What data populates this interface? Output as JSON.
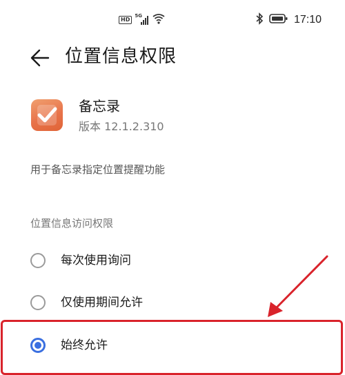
{
  "status_bar": {
    "hd": "HD",
    "network": "5G",
    "time": "17:10",
    "icons": [
      "hd-icon",
      "signal-icon",
      "wifi-icon",
      "bluetooth-icon",
      "battery-icon"
    ]
  },
  "header": {
    "back_icon": "arrow-left-icon",
    "title": "位置信息权限"
  },
  "app": {
    "icon": "memo-app-icon",
    "name": "备忘录",
    "version": "版本 12.1.2.310"
  },
  "purpose": "用于备忘录指定位置提醒功能",
  "section_label": "位置信息访问权限",
  "options": [
    {
      "label": "每次使用询问",
      "selected": false
    },
    {
      "label": "仅使用期间允许",
      "selected": false
    },
    {
      "label": "始终允许",
      "selected": true
    }
  ],
  "annotation": {
    "box_color": "#d9232b",
    "arrow_color": "#d9232b"
  },
  "colors": {
    "accent": "#3a6fe0",
    "app_icon": "#e8734a"
  }
}
